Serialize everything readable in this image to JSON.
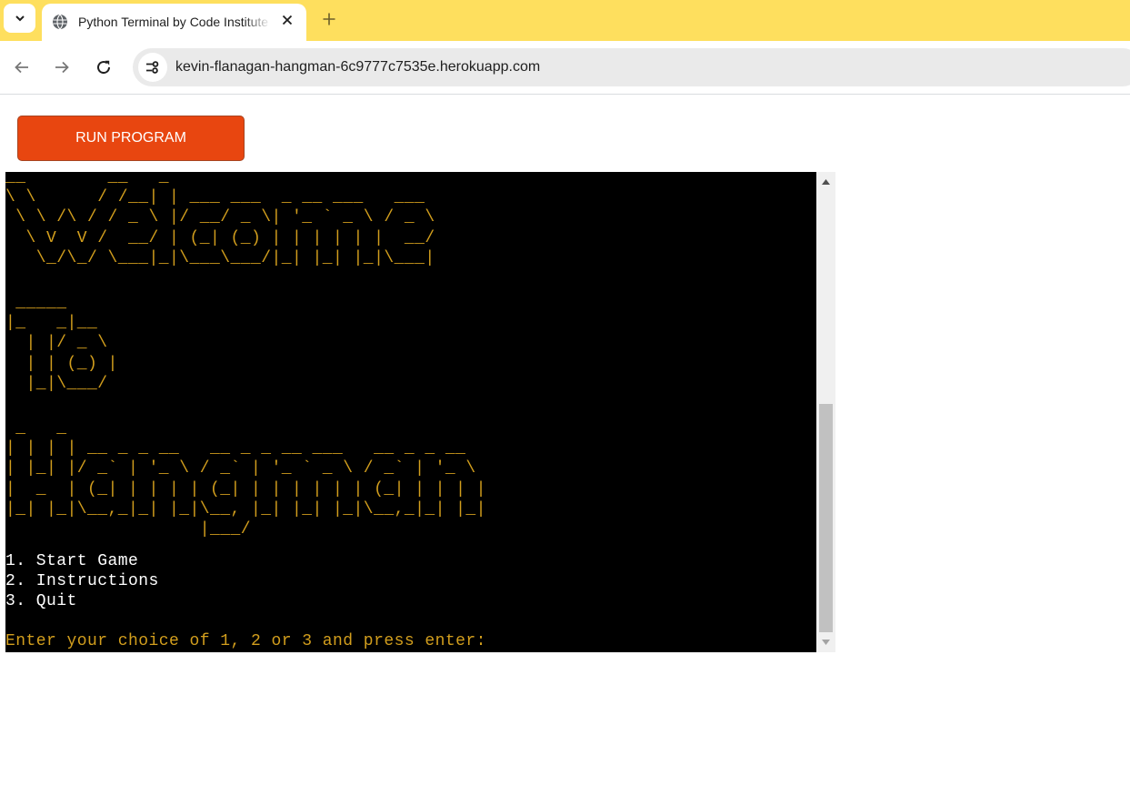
{
  "browser": {
    "tab": {
      "title": "Python Terminal by Code Institute",
      "favicon": "globe-icon"
    },
    "tab_menu_icon": "chevron-down-icon",
    "new_tab_icon": "plus-icon",
    "close_icon": "close-icon",
    "nav": {
      "back_icon": "arrow-left-icon",
      "forward_icon": "arrow-right-icon",
      "reload_icon": "reload-icon",
      "site_info_icon": "tune-icon"
    },
    "url": "kevin-flanagan-hangman-6c9777c7535e.herokuapp.com",
    "colors": {
      "tabbar": "#fedf5e",
      "omnibox": "#eaeaea"
    }
  },
  "page": {
    "run_button_label": "RUN PROGRAM",
    "colors": {
      "run_button": "#e84610",
      "terminal_bg": "#000000",
      "ascii": "#d29e1d",
      "menu_text": "#ffffff"
    }
  },
  "terminal": {
    "ascii_welcome": "__        __   _\n\\ \\      / /__| | ___ ___  _ __ ___   ___\n \\ \\ /\\ / / _ \\ |/ __/ _ \\| '_ ` _ \\ / _ \\\n  \\ V  V /  __/ | (_| (_) | | | | | |  __/\n   \\_/\\_/ \\___|_|\\___\\___/|_| |_| |_|\\___|",
    "ascii_to": " _____\n|_   _|__\n  | |/ _ \\\n  | | (_) |\n  |_|\\___/",
    "ascii_hangman": " _   _\n| | | | __ _ _ __   __ _ _ __ ___   __ _ _ __\n| |_| |/ _` | '_ \\ / _` | '_ ` _ \\ / _` | '_ \\\n|  _  | (_| | | | | (_| | | | | | | (_| | | | |\n|_| |_|\\__,_|_| |_|\\__, |_| |_| |_|\\__,_|_| |_|\n                   |___/",
    "menu": [
      "1. Start Game",
      "2. Instructions",
      "3. Quit"
    ],
    "prompt": "Enter your choice of 1, 2 or 3 and press enter:"
  }
}
